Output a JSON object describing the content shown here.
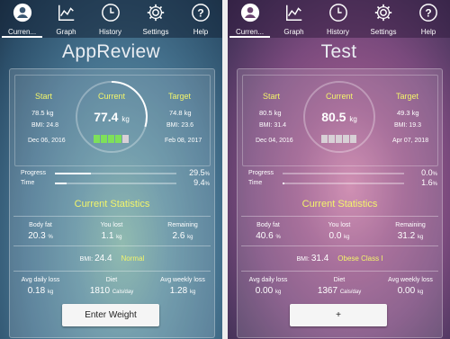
{
  "tabs": [
    {
      "label": "Curren...",
      "icon": "person-icon"
    },
    {
      "label": "Graph",
      "icon": "graph-icon"
    },
    {
      "label": "History",
      "icon": "clock-icon"
    },
    {
      "label": "Settings",
      "icon": "gear-icon"
    },
    {
      "label": "Help",
      "icon": "help-icon"
    }
  ],
  "labels": {
    "start": "Start",
    "current": "Current",
    "target": "Target",
    "progress": "Progress",
    "time": "Time",
    "current_statistics": "Current Statistics",
    "body_fat": "Body fat",
    "you_lost": "You lost",
    "remaining": "Remaining",
    "bmi": "BMI:",
    "avg_daily_loss": "Avg daily loss",
    "diet": "Diet",
    "avg_weekly_loss": "Avg weekly loss",
    "kg": "kg",
    "pct": "%",
    "cals_day": "Cals/day"
  },
  "colors": {
    "accent_yellow": "#f3f56a",
    "block_green": "#7ee05a",
    "block_gray": "#d8d0d6"
  },
  "left": {
    "title": "AppReview",
    "start_weight": "78.5 kg",
    "start_bmi": "BMI: 24.8",
    "start_date": "Dec 06, 2016",
    "current_value": "77.4",
    "target_weight": "74.8 kg",
    "target_bmi": "BMI: 23.6",
    "target_date": "Feb 08, 2017",
    "ring_progress": 0.295,
    "blocks": [
      "green",
      "green",
      "green",
      "green",
      "gray"
    ],
    "progress_value": "29.5",
    "progress_fraction": 0.295,
    "time_value": "9.4",
    "time_fraction": 0.094,
    "body_fat": "20.3",
    "you_lost": "1.1",
    "remaining": "2.6",
    "bmi_value": "24.4",
    "bmi_class": "Normal",
    "avg_daily_loss": "0.18",
    "diet": "1810",
    "avg_weekly_loss": "1.28",
    "button": "Enter Weight"
  },
  "right": {
    "title": "Test",
    "start_weight": "80.5 kg",
    "start_bmi": "BMI: 31.4",
    "start_date": "Dec 04, 2016",
    "current_value": "80.5",
    "target_weight": "49.3 kg",
    "target_bmi": "BMI: 19.3",
    "target_date": "Apr 07, 2018",
    "ring_progress": 0.0,
    "blocks": [
      "gray",
      "gray",
      "gray",
      "gray",
      "gray"
    ],
    "progress_value": "0.0",
    "progress_fraction": 0.0,
    "time_value": "1.6",
    "time_fraction": 0.016,
    "body_fat": "40.6",
    "you_lost": "0.0",
    "remaining": "31.2",
    "bmi_value": "31.4",
    "bmi_class": "Obese Class I",
    "avg_daily_loss": "0.00",
    "diet": "1367",
    "avg_weekly_loss": "0.00",
    "button": "+"
  }
}
